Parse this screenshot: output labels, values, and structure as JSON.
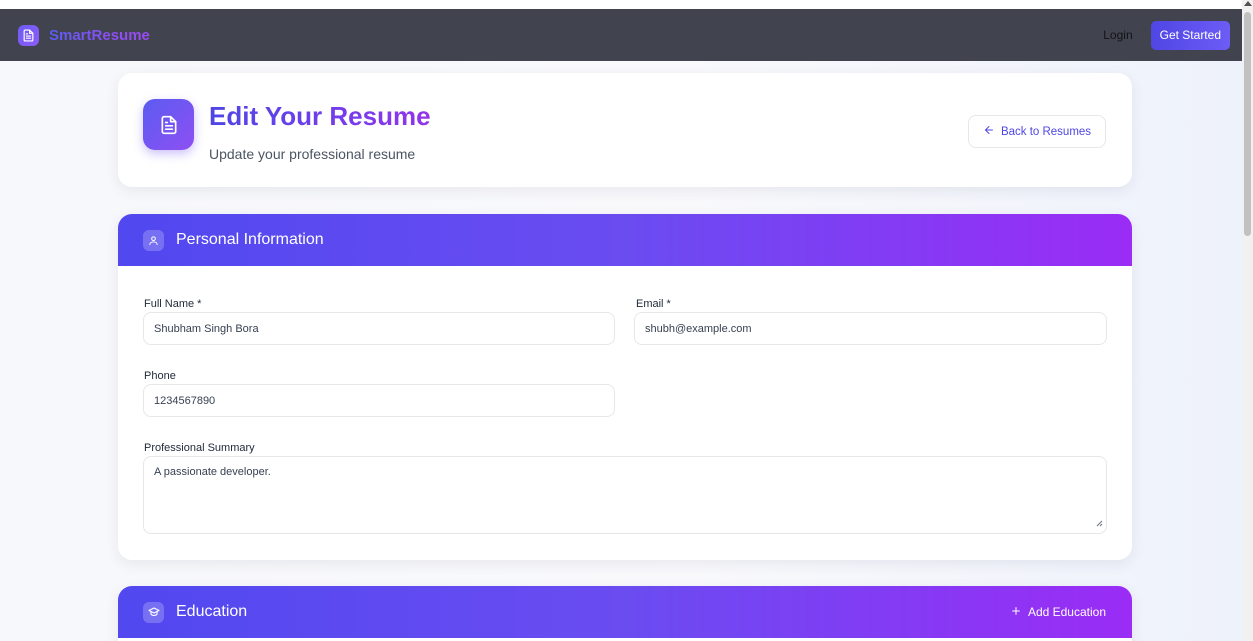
{
  "navbar": {
    "brand_name": "SmartResume",
    "login_label": "Login",
    "get_started_label": "Get Started"
  },
  "header": {
    "title": "Edit Your Resume",
    "subtitle": "Update your professional resume",
    "back_label": "Back to Resumes"
  },
  "personal": {
    "section_title": "Personal Information",
    "full_name_label": "Full Name *",
    "full_name_value": "Shubham Singh Bora",
    "email_label": "Email *",
    "email_value": "shubh@example.com",
    "phone_label": "Phone",
    "phone_value": "1234567890",
    "summary_label": "Professional Summary",
    "summary_value": "A passionate developer."
  },
  "education": {
    "section_title": "Education",
    "add_label": "Add Education"
  },
  "icons": {
    "brand": "document-icon",
    "header": "document-icon",
    "back": "arrow-left-icon",
    "personal": "user-icon",
    "education": "graduation-cap-icon",
    "add": "plus-icon"
  },
  "colors": {
    "navbar_bg": "#41444e",
    "accent_indigo": "#4f46e5",
    "accent_purple": "#9333ea",
    "page_bg": "#f7f8fb"
  }
}
